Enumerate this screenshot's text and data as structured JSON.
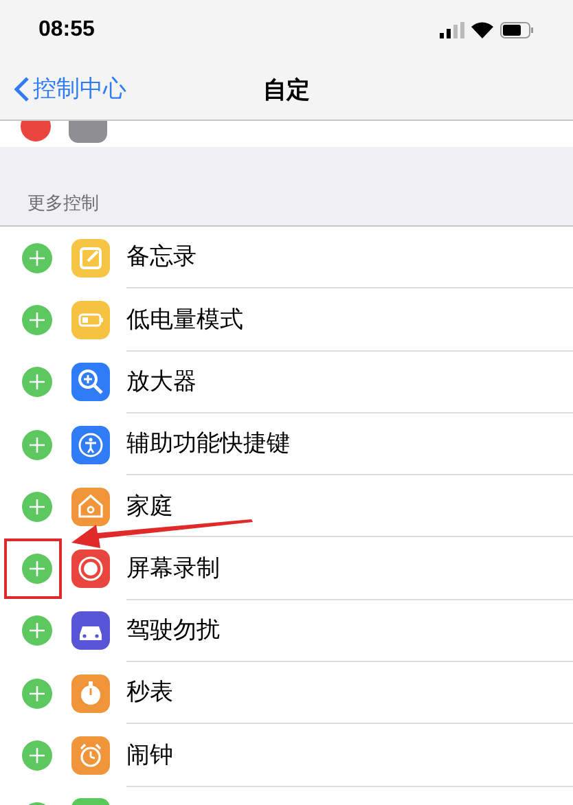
{
  "status_bar": {
    "time": "08:55"
  },
  "nav": {
    "back": "控制中心",
    "title": "自定"
  },
  "section": {
    "header": "更多控制"
  },
  "items": [
    {
      "label": "备忘录",
      "color": "#f7c544",
      "highlighted": false
    },
    {
      "label": "低电量模式",
      "color": "#f5c242",
      "highlighted": false
    },
    {
      "label": "放大器",
      "color": "#2f7cf6",
      "highlighted": false
    },
    {
      "label": "辅助功能快捷键",
      "color": "#2f7cf6",
      "highlighted": false
    },
    {
      "label": "家庭",
      "color": "#f0953a",
      "highlighted": false
    },
    {
      "label": "屏幕录制",
      "color": "#e8453c",
      "highlighted": true
    },
    {
      "label": "驾驶勿扰",
      "color": "#5856d6",
      "highlighted": false
    },
    {
      "label": "秒表",
      "color": "#f0953a",
      "highlighted": false
    },
    {
      "label": "闹钟",
      "color": "#f0953a",
      "highlighted": false
    }
  ]
}
